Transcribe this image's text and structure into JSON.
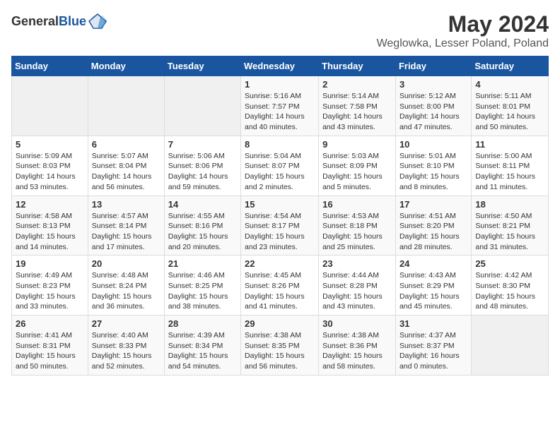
{
  "header": {
    "logo_general": "General",
    "logo_blue": "Blue",
    "title": "May 2024",
    "subtitle": "Weglowka, Lesser Poland, Poland"
  },
  "days_of_week": [
    "Sunday",
    "Monday",
    "Tuesday",
    "Wednesday",
    "Thursday",
    "Friday",
    "Saturday"
  ],
  "weeks": [
    [
      {
        "day": "",
        "info": ""
      },
      {
        "day": "",
        "info": ""
      },
      {
        "day": "",
        "info": ""
      },
      {
        "day": "1",
        "info": "Sunrise: 5:16 AM\nSunset: 7:57 PM\nDaylight: 14 hours\nand 40 minutes."
      },
      {
        "day": "2",
        "info": "Sunrise: 5:14 AM\nSunset: 7:58 PM\nDaylight: 14 hours\nand 43 minutes."
      },
      {
        "day": "3",
        "info": "Sunrise: 5:12 AM\nSunset: 8:00 PM\nDaylight: 14 hours\nand 47 minutes."
      },
      {
        "day": "4",
        "info": "Sunrise: 5:11 AM\nSunset: 8:01 PM\nDaylight: 14 hours\nand 50 minutes."
      }
    ],
    [
      {
        "day": "5",
        "info": "Sunrise: 5:09 AM\nSunset: 8:03 PM\nDaylight: 14 hours\nand 53 minutes."
      },
      {
        "day": "6",
        "info": "Sunrise: 5:07 AM\nSunset: 8:04 PM\nDaylight: 14 hours\nand 56 minutes."
      },
      {
        "day": "7",
        "info": "Sunrise: 5:06 AM\nSunset: 8:06 PM\nDaylight: 14 hours\nand 59 minutes."
      },
      {
        "day": "8",
        "info": "Sunrise: 5:04 AM\nSunset: 8:07 PM\nDaylight: 15 hours\nand 2 minutes."
      },
      {
        "day": "9",
        "info": "Sunrise: 5:03 AM\nSunset: 8:09 PM\nDaylight: 15 hours\nand 5 minutes."
      },
      {
        "day": "10",
        "info": "Sunrise: 5:01 AM\nSunset: 8:10 PM\nDaylight: 15 hours\nand 8 minutes."
      },
      {
        "day": "11",
        "info": "Sunrise: 5:00 AM\nSunset: 8:11 PM\nDaylight: 15 hours\nand 11 minutes."
      }
    ],
    [
      {
        "day": "12",
        "info": "Sunrise: 4:58 AM\nSunset: 8:13 PM\nDaylight: 15 hours\nand 14 minutes."
      },
      {
        "day": "13",
        "info": "Sunrise: 4:57 AM\nSunset: 8:14 PM\nDaylight: 15 hours\nand 17 minutes."
      },
      {
        "day": "14",
        "info": "Sunrise: 4:55 AM\nSunset: 8:16 PM\nDaylight: 15 hours\nand 20 minutes."
      },
      {
        "day": "15",
        "info": "Sunrise: 4:54 AM\nSunset: 8:17 PM\nDaylight: 15 hours\nand 23 minutes."
      },
      {
        "day": "16",
        "info": "Sunrise: 4:53 AM\nSunset: 8:18 PM\nDaylight: 15 hours\nand 25 minutes."
      },
      {
        "day": "17",
        "info": "Sunrise: 4:51 AM\nSunset: 8:20 PM\nDaylight: 15 hours\nand 28 minutes."
      },
      {
        "day": "18",
        "info": "Sunrise: 4:50 AM\nSunset: 8:21 PM\nDaylight: 15 hours\nand 31 minutes."
      }
    ],
    [
      {
        "day": "19",
        "info": "Sunrise: 4:49 AM\nSunset: 8:23 PM\nDaylight: 15 hours\nand 33 minutes."
      },
      {
        "day": "20",
        "info": "Sunrise: 4:48 AM\nSunset: 8:24 PM\nDaylight: 15 hours\nand 36 minutes."
      },
      {
        "day": "21",
        "info": "Sunrise: 4:46 AM\nSunset: 8:25 PM\nDaylight: 15 hours\nand 38 minutes."
      },
      {
        "day": "22",
        "info": "Sunrise: 4:45 AM\nSunset: 8:26 PM\nDaylight: 15 hours\nand 41 minutes."
      },
      {
        "day": "23",
        "info": "Sunrise: 4:44 AM\nSunset: 8:28 PM\nDaylight: 15 hours\nand 43 minutes."
      },
      {
        "day": "24",
        "info": "Sunrise: 4:43 AM\nSunset: 8:29 PM\nDaylight: 15 hours\nand 45 minutes."
      },
      {
        "day": "25",
        "info": "Sunrise: 4:42 AM\nSunset: 8:30 PM\nDaylight: 15 hours\nand 48 minutes."
      }
    ],
    [
      {
        "day": "26",
        "info": "Sunrise: 4:41 AM\nSunset: 8:31 PM\nDaylight: 15 hours\nand 50 minutes."
      },
      {
        "day": "27",
        "info": "Sunrise: 4:40 AM\nSunset: 8:33 PM\nDaylight: 15 hours\nand 52 minutes."
      },
      {
        "day": "28",
        "info": "Sunrise: 4:39 AM\nSunset: 8:34 PM\nDaylight: 15 hours\nand 54 minutes."
      },
      {
        "day": "29",
        "info": "Sunrise: 4:38 AM\nSunset: 8:35 PM\nDaylight: 15 hours\nand 56 minutes."
      },
      {
        "day": "30",
        "info": "Sunrise: 4:38 AM\nSunset: 8:36 PM\nDaylight: 15 hours\nand 58 minutes."
      },
      {
        "day": "31",
        "info": "Sunrise: 4:37 AM\nSunset: 8:37 PM\nDaylight: 16 hours\nand 0 minutes."
      },
      {
        "day": "",
        "info": ""
      }
    ]
  ]
}
